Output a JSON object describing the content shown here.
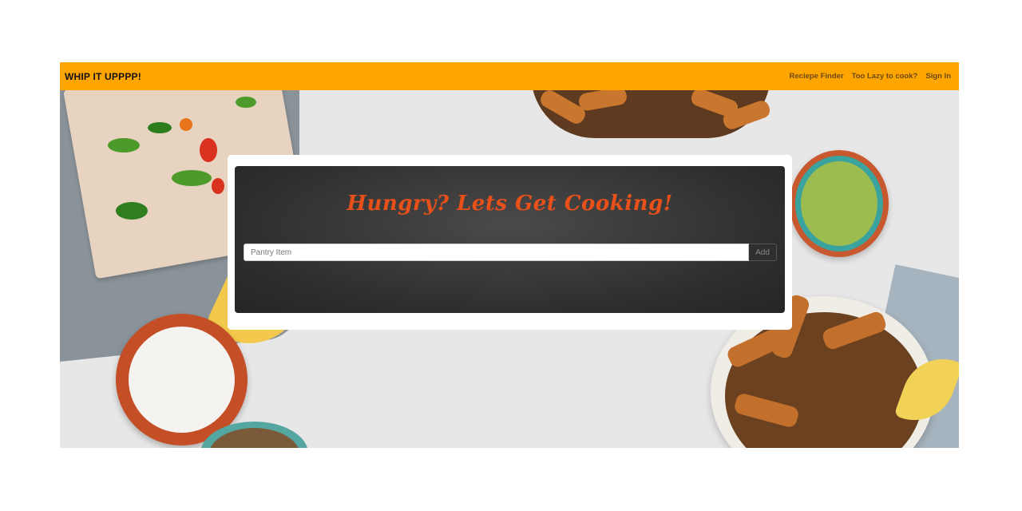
{
  "navbar": {
    "brand": "WHIP IT UPPPP!",
    "links": [
      "Reciepe Finder",
      "Too Lazy to cook?",
      "Sign In"
    ],
    "background_color": "#ffa500"
  },
  "hero": {
    "headline": "Hungry? Lets Get Cooking!",
    "headline_color": "#e8501a",
    "search": {
      "placeholder": "Pantry Item",
      "value": "",
      "button_label": "Add"
    }
  }
}
